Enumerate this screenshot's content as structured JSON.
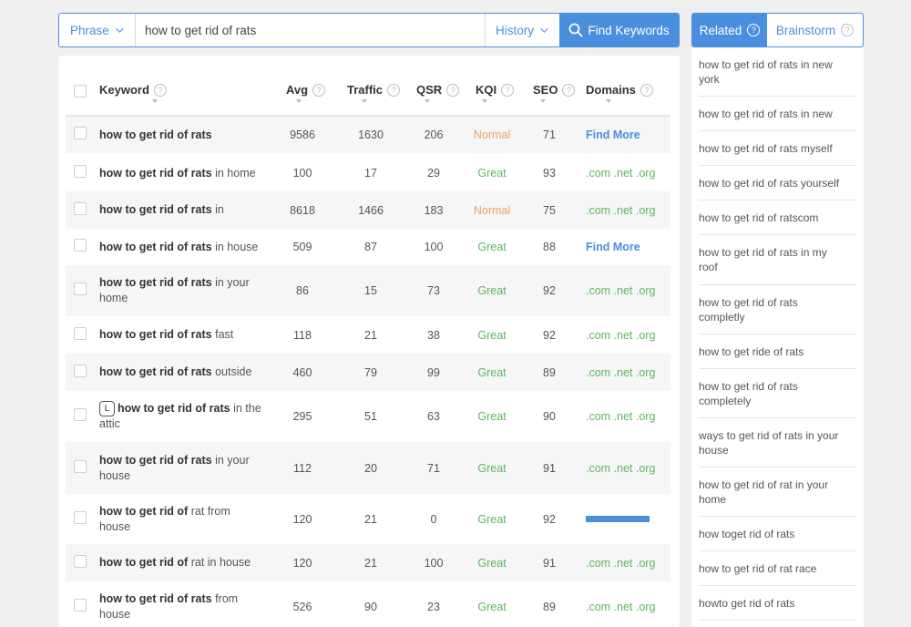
{
  "search": {
    "mode_label": "Phrase",
    "query": "how to get rid of rats",
    "history_label": "History",
    "find_label": "Find Keywords"
  },
  "table": {
    "headers": {
      "keyword": "Keyword",
      "avg": "Avg",
      "traffic": "Traffic",
      "qsr": "QSR",
      "kqi": "KQI",
      "seo": "SEO",
      "domains": "Domains"
    },
    "rows": [
      {
        "bold": "how to get rid of rats",
        "rest": "",
        "badge": null,
        "avg": "9586",
        "traffic": "1630",
        "qsr": "206",
        "kqi": "Normal",
        "seo": "71",
        "domains": "Find More",
        "domains_type": "link"
      },
      {
        "bold": "how to get rid of rats",
        "rest": "in home",
        "badge": null,
        "avg": "100",
        "traffic": "17",
        "qsr": "29",
        "kqi": "Great",
        "seo": "93",
        "domains": ".com .net .org",
        "domains_type": "tlds"
      },
      {
        "bold": "how to get rid of rats",
        "rest": "in",
        "badge": null,
        "avg": "8618",
        "traffic": "1466",
        "qsr": "183",
        "kqi": "Normal",
        "seo": "75",
        "domains": ".com .net .org",
        "domains_type": "tlds"
      },
      {
        "bold": "how to get rid of rats",
        "rest": "in house",
        "badge": null,
        "avg": "509",
        "traffic": "87",
        "qsr": "100",
        "kqi": "Great",
        "seo": "88",
        "domains": "Find More",
        "domains_type": "link"
      },
      {
        "bold": "how to get rid of rats",
        "rest": "in your home",
        "badge": null,
        "avg": "86",
        "traffic": "15",
        "qsr": "73",
        "kqi": "Great",
        "seo": "92",
        "domains": ".com .net .org",
        "domains_type": "tlds"
      },
      {
        "bold": "how to get rid of rats",
        "rest": "fast",
        "badge": null,
        "avg": "118",
        "traffic": "21",
        "qsr": "38",
        "kqi": "Great",
        "seo": "92",
        "domains": ".com .net .org",
        "domains_type": "tlds"
      },
      {
        "bold": "how to get rid of rats",
        "rest": "outside",
        "badge": null,
        "avg": "460",
        "traffic": "79",
        "qsr": "99",
        "kqi": "Great",
        "seo": "89",
        "domains": ".com .net .org",
        "domains_type": "tlds"
      },
      {
        "bold": "how to get rid of rats",
        "rest": "in the attic",
        "badge": "L",
        "avg": "295",
        "traffic": "51",
        "qsr": "63",
        "kqi": "Great",
        "seo": "90",
        "domains": ".com .net .org",
        "domains_type": "tlds"
      },
      {
        "bold": "how to get rid of rats",
        "rest": "in your house",
        "badge": null,
        "avg": "112",
        "traffic": "20",
        "qsr": "71",
        "kqi": "Great",
        "seo": "91",
        "domains": ".com .net .org",
        "domains_type": "tlds"
      },
      {
        "bold": "how to get rid of",
        "rest": "rat from house",
        "badge": null,
        "avg": "120",
        "traffic": "21",
        "qsr": "0",
        "kqi": "Great",
        "seo": "92",
        "domains": "",
        "domains_type": "loading"
      },
      {
        "bold": "how to get rid of",
        "rest": "rat in house",
        "badge": null,
        "avg": "120",
        "traffic": "21",
        "qsr": "100",
        "kqi": "Great",
        "seo": "91",
        "domains": ".com .net .org",
        "domains_type": "tlds"
      },
      {
        "bold": "how to get rid of rats",
        "rest": "from house",
        "badge": null,
        "avg": "526",
        "traffic": "90",
        "qsr": "23",
        "kqi": "Great",
        "seo": "89",
        "domains": ".com .net .org",
        "domains_type": "tlds"
      }
    ]
  },
  "sidebar": {
    "tabs": [
      {
        "label": "Related",
        "active": true
      },
      {
        "label": "Brainstorm",
        "active": false
      }
    ],
    "related": [
      "how to get rid of rats in new york",
      "how to get rid of rats in new",
      "how to get rid of rats myself",
      "how to get rid of rats yourself",
      "how to get rid of ratscom",
      "how to get rid of rats in my roof",
      "how to get rid of rats completly",
      "how to get ride of rats",
      "how to get rid of rats completely",
      "ways to get rid of rats in your house",
      "how to get rid of rat in your home",
      "how toget rid of rats",
      "how to get rid of rat race",
      "howto get rid of rats"
    ]
  },
  "colors": {
    "accent": "#4a8fde",
    "kqi_normal": "#f5a05a",
    "kqi_great": "#5cb85c"
  }
}
